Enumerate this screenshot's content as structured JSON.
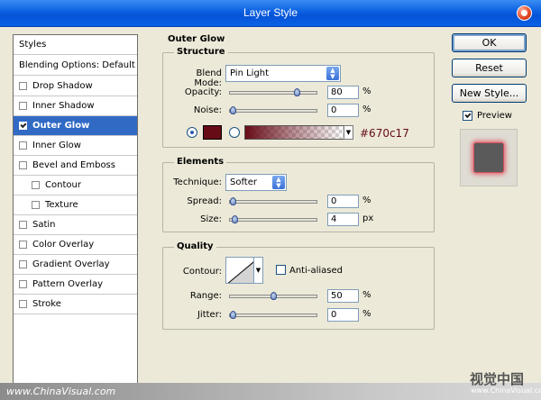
{
  "window": {
    "title": "Layer Style"
  },
  "styles_panel": {
    "header": "Styles",
    "blending": "Blending Options: Default",
    "items": [
      {
        "label": "Drop Shadow",
        "checked": false
      },
      {
        "label": "Inner Shadow",
        "checked": false
      },
      {
        "label": "Outer Glow",
        "checked": true,
        "selected": true
      },
      {
        "label": "Inner Glow",
        "checked": false
      },
      {
        "label": "Bevel and Emboss",
        "checked": false
      },
      {
        "label": "Contour",
        "checked": false,
        "sub": true
      },
      {
        "label": "Texture",
        "checked": false,
        "sub": true
      },
      {
        "label": "Satin",
        "checked": false
      },
      {
        "label": "Color Overlay",
        "checked": false
      },
      {
        "label": "Gradient Overlay",
        "checked": false
      },
      {
        "label": "Pattern Overlay",
        "checked": false
      },
      {
        "label": "Stroke",
        "checked": false
      }
    ]
  },
  "outer_glow": {
    "title": "Outer Glow",
    "structure": {
      "title": "Structure",
      "blend_mode_label": "Blend Mode:",
      "blend_mode": "Pin Light",
      "opacity_label": "Opacity:",
      "opacity": "80",
      "opacity_level": 0.8,
      "noise_label": "Noise:",
      "noise": "0",
      "noise_level": 0,
      "color": "#670c17",
      "color_hex_label": "#670c17",
      "percent": "%"
    },
    "elements": {
      "title": "Elements",
      "technique_label": "Technique:",
      "technique": "Softer",
      "spread_label": "Spread:",
      "spread": "0",
      "spread_level": 0,
      "size_label": "Size:",
      "size": "4",
      "size_level": 0.02,
      "px": "px",
      "percent": "%"
    },
    "quality": {
      "title": "Quality",
      "contour_label": "Contour:",
      "anti_aliased_label": "Anti-aliased",
      "range_label": "Range:",
      "range": "50",
      "range_level": 0.5,
      "jitter_label": "Jitter:",
      "jitter": "0",
      "jitter_level": 0,
      "percent": "%"
    }
  },
  "buttons": {
    "ok": "OK",
    "reset": "Reset",
    "new_style": "New Style...",
    "preview_label": "Preview"
  },
  "watermark": {
    "left": "www.ChinaVisual.com",
    "logo": "视觉中国",
    "right": "www.ChinaVisual.com"
  }
}
